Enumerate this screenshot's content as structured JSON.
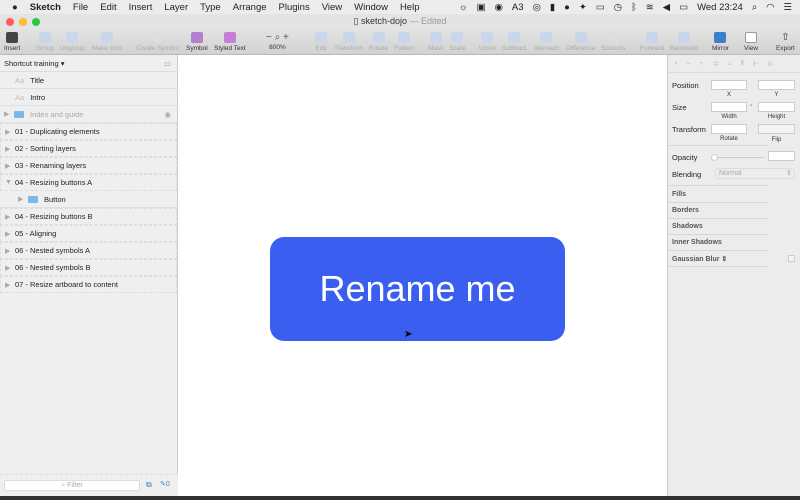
{
  "menubar": {
    "apple": "",
    "app": "Sketch",
    "items": [
      "File",
      "Edit",
      "Insert",
      "Layer",
      "Type",
      "Arrange",
      "Plugins",
      "View",
      "Window",
      "Help"
    ],
    "status_ai": "3",
    "clock": "Wed 23:24"
  },
  "window": {
    "title": "sketch-dojo",
    "status": "— Edited"
  },
  "toolbar": {
    "insert": "Insert",
    "group": "Group",
    "ungroup": "Ungroup",
    "make_grid": "Make Grid",
    "create_symbol": "Create Symbol",
    "symbol": "Symbol",
    "styled_text": "Styled Text",
    "zoom": "800%",
    "edit": "Edit",
    "transform": "Transform",
    "rotate": "Rotate",
    "flatten": "Flatten",
    "mask": "Mask",
    "scale": "Scale",
    "union": "Union",
    "subtract": "Subtract",
    "intersect": "Intersect",
    "difference": "Difference",
    "scissors": "Scissors",
    "forward": "Forward",
    "backward": "Backward",
    "mirror": "Mirror",
    "view": "View",
    "export": "Export"
  },
  "layers": {
    "page": "Shortcut training",
    "items": [
      {
        "label": "Title",
        "type": "text"
      },
      {
        "label": "Intro",
        "type": "text"
      },
      {
        "label": "Index and guide",
        "type": "folder-hidden"
      },
      {
        "label": "01 - Duplicating elements",
        "type": "artboard"
      },
      {
        "label": "02 - Sorting layers",
        "type": "artboard"
      },
      {
        "label": "03 - Renaming layers",
        "type": "artboard"
      },
      {
        "label": "04 - Resizing buttons A",
        "type": "artboard-open"
      },
      {
        "label": "Button",
        "type": "child-folder"
      },
      {
        "label": "04 - Resizing buttons B",
        "type": "artboard"
      },
      {
        "label": "05 - Aligning",
        "type": "artboard"
      },
      {
        "label": "06 - Nested symbols A",
        "type": "artboard"
      },
      {
        "label": "06 - Nested symbols B",
        "type": "artboard"
      },
      {
        "label": "07 - Resize artboard to content",
        "type": "artboard"
      }
    ],
    "filter_placeholder": "Filter",
    "slice_count": "0"
  },
  "canvas": {
    "button_label": "Rename me",
    "button_color": "#395ef0"
  },
  "inspector": {
    "position": "Position",
    "x": "X",
    "y": "Y",
    "size": "Size",
    "width": "Width",
    "height": "Height",
    "transform": "Transform",
    "rotate": "Rotate",
    "flip": "Flip",
    "opacity": "Opacity",
    "blending": "Blending",
    "blending_value": "Normal",
    "fills": "Fills",
    "borders": "Borders",
    "shadows": "Shadows",
    "inner_shadows": "Inner Shadows",
    "gaussian_blur": "Gaussian Blur"
  }
}
